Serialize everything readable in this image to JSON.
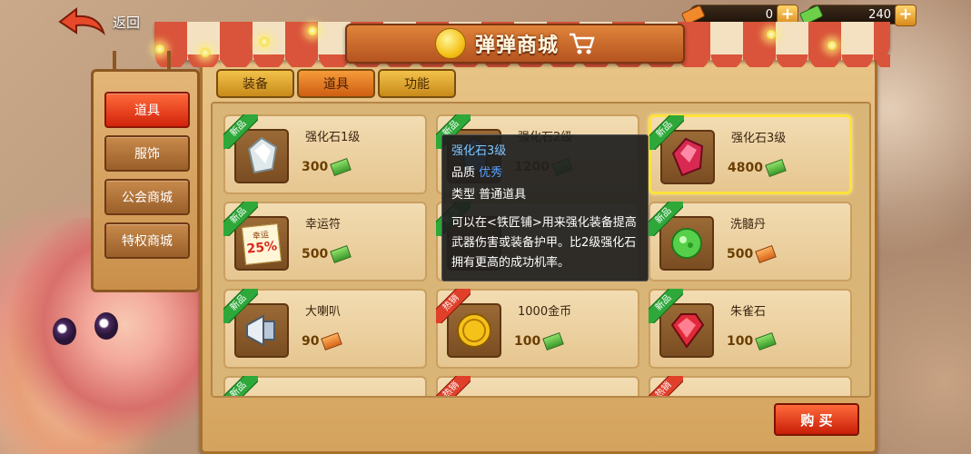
{
  "nav": {
    "back_label": "返回"
  },
  "currency": [
    {
      "icon": "voucher-icon",
      "value": "0"
    },
    {
      "icon": "cash-icon",
      "value": "240"
    }
  ],
  "shop": {
    "title": "弹弹商城"
  },
  "sidebar": {
    "items": [
      {
        "label": "道具",
        "active": true
      },
      {
        "label": "服饰",
        "active": false
      },
      {
        "label": "公会商城",
        "active": false
      },
      {
        "label": "特权商城",
        "active": false
      }
    ]
  },
  "tabs": [
    {
      "label": "装备",
      "active": false
    },
    {
      "label": "道具",
      "active": true
    },
    {
      "label": "功能",
      "active": false
    }
  ],
  "items": [
    {
      "name": "强化石1级",
      "price": "300",
      "badge": "新品",
      "currency": "green",
      "icon": "crystal-white-icon"
    },
    {
      "name": "强化石2级",
      "price": "1200",
      "badge": "新品",
      "currency": "green",
      "icon": "crystal-blue-icon"
    },
    {
      "name": "强化石3级",
      "price": "4800",
      "badge": "新品",
      "currency": "green",
      "icon": "crystal-red-icon"
    },
    {
      "name": "幸运符",
      "price": "500",
      "badge": "新品",
      "currency": "green",
      "icon": "lucky-charm-icon"
    },
    {
      "name": "",
      "price": "",
      "badge": "新品",
      "currency": "green",
      "icon": "item-icon"
    },
    {
      "name": "洗髓丹",
      "price": "500",
      "badge": "新品",
      "currency": "orange",
      "icon": "green-pill-icon"
    },
    {
      "name": "大喇叭",
      "price": "90",
      "badge": "新品",
      "currency": "orange",
      "icon": "megaphone-icon"
    },
    {
      "name": "1000金币",
      "price": "100",
      "badge": "热销",
      "currency": "green",
      "icon": "gold-coin-icon"
    },
    {
      "name": "朱雀石",
      "price": "100",
      "badge": "新品",
      "currency": "green",
      "icon": "red-gem-icon"
    }
  ],
  "lucky_charm_text": {
    "top": "幸运",
    "pct": "25%"
  },
  "tooltip": {
    "name": "强化石3级",
    "quality_label": "品质",
    "quality_value": "优秀",
    "type_label": "类型",
    "type_value": "普通道具",
    "description": "可以在<铁匠铺>用来强化装备提高武器伤害或装备护甲。比2级强化石拥有更高的成功机率。"
  },
  "buy_label": "购 买"
}
